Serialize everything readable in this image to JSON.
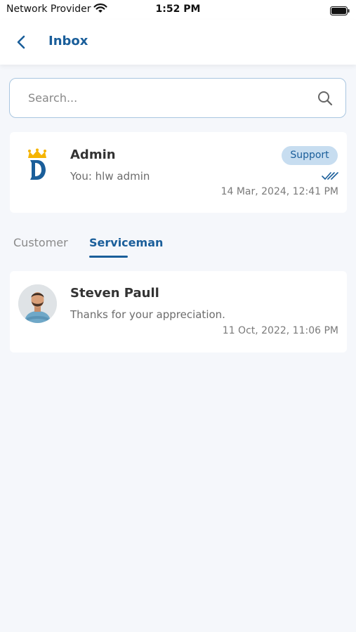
{
  "status_bar": {
    "carrier": "Network Provider",
    "time": "1:52 PM"
  },
  "header": {
    "title": "Inbox",
    "back_icon": "chevron-left-icon"
  },
  "search": {
    "placeholder": "Search...",
    "value": "",
    "icon": "search-icon"
  },
  "support_chat": {
    "name": "Admin",
    "preview": "You: hlw admin",
    "badge": "Support",
    "timestamp": "14 Mar, 2024, 12:41 PM",
    "read_icon": "double-check-icon"
  },
  "tabs": [
    {
      "label": "Customer",
      "active": false
    },
    {
      "label": "Serviceman",
      "active": true
    }
  ],
  "conversations": [
    {
      "name": "Steven Paull",
      "preview": "Thanks for your appreciation.",
      "timestamp": "11 Oct, 2022, 11:06 PM"
    }
  ],
  "colors": {
    "primary": "#1a5e9a",
    "badge_bg": "#c7ddf0",
    "background": "#f5f7fb"
  }
}
